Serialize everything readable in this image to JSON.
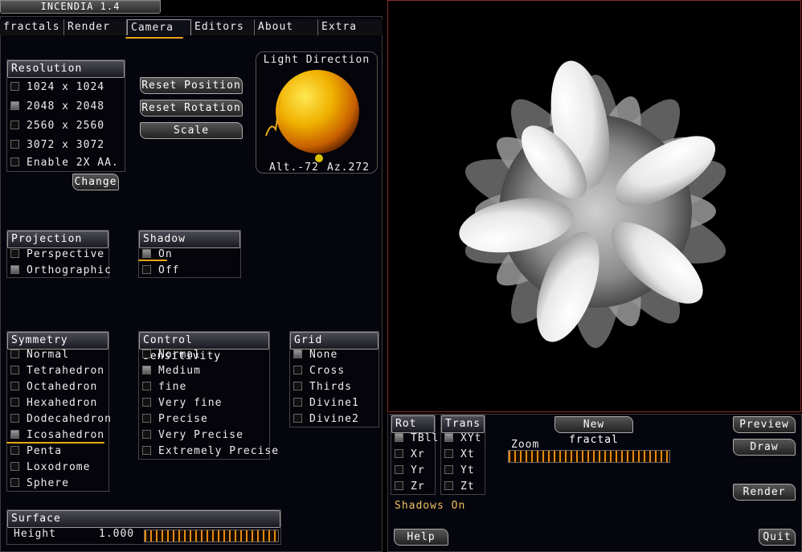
{
  "app": {
    "title": "INCENDIA 1.4"
  },
  "tabs": [
    {
      "label": "fractals"
    },
    {
      "label": "Render"
    },
    {
      "label": "Camera"
    },
    {
      "label": "Editors"
    },
    {
      "label": "About"
    },
    {
      "label": "Extra"
    }
  ],
  "resolution": {
    "header": "Resolution",
    "options": [
      {
        "label": "1024 x 1024",
        "checked": false
      },
      {
        "label": "2048 x 2048",
        "checked": true
      },
      {
        "label": "2560 x 2560",
        "checked": false
      },
      {
        "label": "3072 x 3072",
        "checked": false
      },
      {
        "label": "Enable 2X AA.",
        "checked": false
      }
    ],
    "change_label": "Change"
  },
  "camera_buttons": {
    "reset_position": "Reset Position",
    "reset_rotation": "Reset Rotation",
    "scale": "Scale"
  },
  "light": {
    "header": "Light Direction",
    "alt": "Alt.-72",
    "az": "Az.272"
  },
  "projection": {
    "header": "Projection",
    "options": [
      {
        "label": "Perspective",
        "checked": false
      },
      {
        "label": "Orthographic",
        "checked": true
      }
    ]
  },
  "shadow": {
    "header": "Shadow",
    "options": [
      {
        "label": "On",
        "checked": true
      },
      {
        "label": "Off",
        "checked": false
      }
    ]
  },
  "symmetry": {
    "header": "Symmetry",
    "options": [
      {
        "label": "Normal",
        "checked": false
      },
      {
        "label": "Tetrahedron",
        "checked": false
      },
      {
        "label": "Octahedron",
        "checked": false
      },
      {
        "label": "Hexahedron",
        "checked": false
      },
      {
        "label": "Dodecahedron",
        "checked": false
      },
      {
        "label": "Icosahedron",
        "checked": true
      },
      {
        "label": "Penta",
        "checked": false
      },
      {
        "label": "Loxodrome",
        "checked": false
      },
      {
        "label": "Sphere",
        "checked": false
      }
    ]
  },
  "sensitivity": {
    "header": "Control Sensitivity",
    "options": [
      {
        "label": "Normal",
        "checked": false
      },
      {
        "label": "Medium",
        "checked": true
      },
      {
        "label": "fine",
        "checked": false
      },
      {
        "label": "Very fine",
        "checked": false
      },
      {
        "label": "Precise",
        "checked": false
      },
      {
        "label": "Very Precise",
        "checked": false
      },
      {
        "label": "Extremely Precise",
        "checked": false
      }
    ]
  },
  "grid": {
    "header": "Grid",
    "options": [
      {
        "label": "None",
        "checked": true
      },
      {
        "label": "Cross",
        "checked": false
      },
      {
        "label": "Thirds",
        "checked": false
      },
      {
        "label": "Divine1",
        "checked": false
      },
      {
        "label": "Divine2",
        "checked": false
      }
    ]
  },
  "surface": {
    "header": "Surface",
    "height_label": "Height",
    "height_value": "1.000"
  },
  "rot": {
    "header": "Rot",
    "options": [
      {
        "label": "TBll",
        "checked": true
      },
      {
        "label": "Xr",
        "checked": false
      },
      {
        "label": "Yr",
        "checked": false
      },
      {
        "label": "Zr",
        "checked": false
      }
    ]
  },
  "trans": {
    "header": "Trans",
    "options": [
      {
        "label": "XYt",
        "checked": true
      },
      {
        "label": "Xt",
        "checked": false
      },
      {
        "label": "Yt",
        "checked": false
      },
      {
        "label": "Zt",
        "checked": false
      }
    ]
  },
  "bottom": {
    "new_fractal": "New fractal",
    "zoom_label": "Zoom",
    "shadows_status": "Shadows On",
    "help": "Help",
    "preview": "Preview",
    "draw": "Draw",
    "render": "Render",
    "quit": "Quit"
  },
  "colors": {
    "accent": "#e6a817",
    "viewport_border": "#8a2a2a",
    "slider": "#e68a10"
  }
}
